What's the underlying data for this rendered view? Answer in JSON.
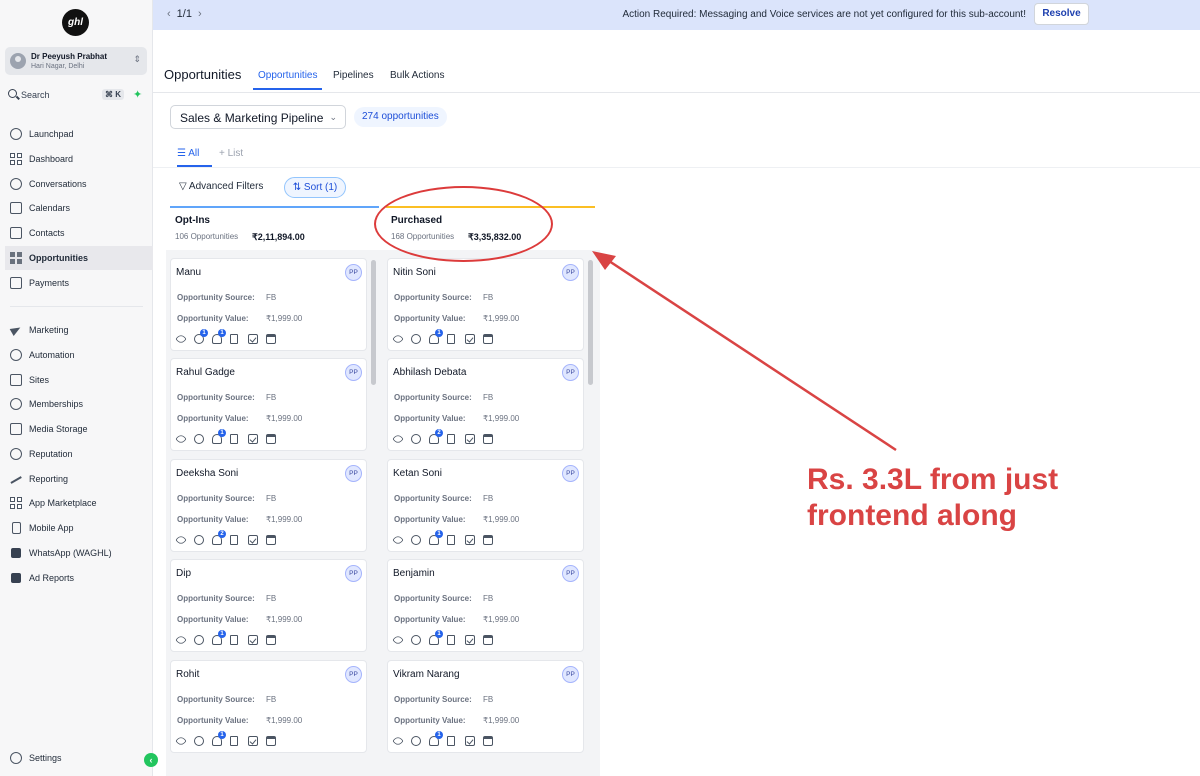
{
  "app": {
    "logo_text": "ghl",
    "account_name": "Dr Peeyush Prabhat",
    "account_location": "Hari Nagar, Delhi",
    "search_label": "Search",
    "search_shortcut": "⌘ K"
  },
  "sidebar": {
    "items": [
      {
        "label": "Launchpad",
        "icon": "launchpad-icon"
      },
      {
        "label": "Dashboard",
        "icon": "dashboard-icon"
      },
      {
        "label": "Conversations",
        "icon": "chat-icon"
      },
      {
        "label": "Calendars",
        "icon": "calendar-icon"
      },
      {
        "label": "Contacts",
        "icon": "contacts-icon"
      },
      {
        "label": "Opportunities",
        "icon": "opportunities-icon",
        "active": true
      },
      {
        "label": "Payments",
        "icon": "payments-icon"
      }
    ],
    "items2": [
      {
        "label": "Marketing",
        "icon": "send-icon"
      },
      {
        "label": "Automation",
        "icon": "automation-icon"
      },
      {
        "label": "Sites",
        "icon": "sites-icon"
      },
      {
        "label": "Memberships",
        "icon": "memberships-icon"
      },
      {
        "label": "Media Storage",
        "icon": "media-icon"
      },
      {
        "label": "Reputation",
        "icon": "reputation-icon"
      },
      {
        "label": "Reporting",
        "icon": "reporting-icon"
      },
      {
        "label": "App Marketplace",
        "icon": "marketplace-icon"
      },
      {
        "label": "Mobile App",
        "icon": "mobile-icon"
      },
      {
        "label": "WhatsApp (WAGHL)",
        "icon": "whatsapp-icon"
      },
      {
        "label": "Ad Reports",
        "icon": "ad-reports-icon"
      }
    ],
    "settings_label": "Settings"
  },
  "banner": {
    "pager": "1/1",
    "message": "Action Required: Messaging and Voice services are not yet configured for this sub-account!",
    "resolve_label": "Resolve"
  },
  "header": {
    "title": "Opportunities",
    "tabs": [
      "Opportunities",
      "Pipelines",
      "Bulk Actions"
    ]
  },
  "toolbar": {
    "pipeline": "Sales & Marketing Pipeline",
    "count": "274 opportunities",
    "view_all": "All",
    "view_list": "List",
    "advanced_filters": "Advanced Filters",
    "sort": "Sort (1)"
  },
  "columns": [
    {
      "title": "Opt-Ins",
      "count": "106 Opportunities",
      "value": "₹2,11,894.00",
      "accent": "#60a5fa",
      "cards": [
        {
          "name": "Manu",
          "badges": [
            "1",
            "1"
          ]
        },
        {
          "name": "Rahul Gadge",
          "badges": [
            "",
            "1"
          ]
        },
        {
          "name": "Deeksha Soni",
          "badges": [
            "",
            "2"
          ]
        },
        {
          "name": "Dip",
          "badges": [
            "",
            "1"
          ]
        },
        {
          "name": "Rohit",
          "badges": [
            "",
            "1"
          ]
        }
      ]
    },
    {
      "title": "Purchased",
      "count": "168 Opportunities",
      "value": "₹3,35,832.00",
      "accent": "#fbbf24",
      "cards": [
        {
          "name": "Nitin Soni",
          "badges": [
            "",
            "1"
          ]
        },
        {
          "name": "Abhilash Debata",
          "badges": [
            "",
            "2"
          ]
        },
        {
          "name": "Ketan Soni",
          "badges": [
            "",
            "1"
          ]
        },
        {
          "name": "Benjamin",
          "badges": [
            "",
            "1"
          ]
        },
        {
          "name": "Vikram Narang",
          "badges": [
            "",
            "1"
          ]
        }
      ]
    }
  ],
  "card_fields": {
    "source_label": "Opportunity Source:",
    "source_value": "FB",
    "value_label": "Opportunity Value:",
    "value_value": "₹1,999.00",
    "owner_initials": "PP"
  },
  "annotation": {
    "text": "Rs. 3.3L from just frontend along",
    "color": "#d94444"
  }
}
